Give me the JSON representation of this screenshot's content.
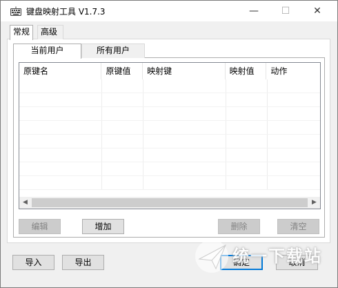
{
  "window": {
    "title": "键盘映射工具 V1.7.3",
    "min_glyph": "—",
    "max_glyph": "☐",
    "close_glyph": "✕",
    "icon": "keyboard-icon"
  },
  "outer_tabs": [
    {
      "label": "常规",
      "active": true
    },
    {
      "label": "高级",
      "active": false
    }
  ],
  "inner_tabs": [
    {
      "label": "当前用户",
      "active": true
    },
    {
      "label": "所有用户",
      "active": false
    }
  ],
  "table": {
    "columns": [
      "原键名",
      "原键值",
      "映射键",
      "映射值",
      "动作"
    ],
    "rows": []
  },
  "scrollbar": {
    "left_glyph": "◀",
    "right_glyph": "▶"
  },
  "buttons": {
    "edit": "编辑",
    "add": "增加",
    "delete": "删除",
    "clear": "清空",
    "import": "导入",
    "export": "导出",
    "ok": "确定",
    "cancel": "取消"
  },
  "watermark": {
    "text": "统一下载站"
  }
}
